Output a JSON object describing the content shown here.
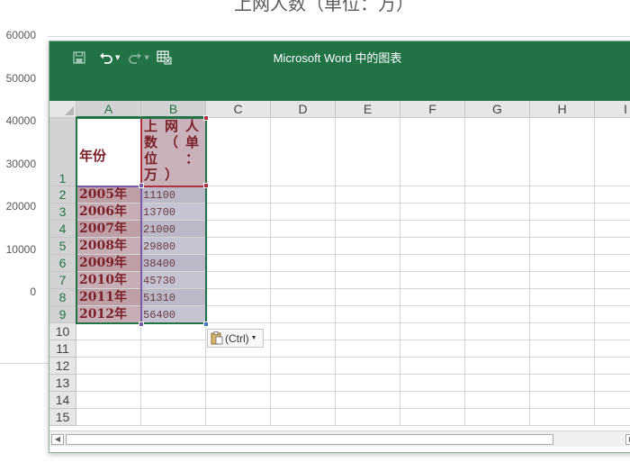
{
  "background": {
    "chart_title": "上网人数（单位：万）",
    "y_ticks": [
      "60000",
      "50000",
      "40000",
      "30000",
      "20000",
      "10000",
      "0"
    ]
  },
  "window": {
    "title": "Microsoft Word 中的图表"
  },
  "quick_access": {
    "save_icon": "save-icon",
    "undo_icon": "undo-icon",
    "redo_icon": "redo-icon",
    "edit_data_icon": "edit-data-in-excel-icon"
  },
  "columns": [
    "A",
    "B",
    "C",
    "D",
    "E",
    "F",
    "G",
    "H",
    "I"
  ],
  "rows": [
    "1",
    "2",
    "3",
    "4",
    "5",
    "6",
    "7",
    "8",
    "9",
    "10",
    "11",
    "12",
    "13",
    "14",
    "15"
  ],
  "header_row": {
    "a1": "年份",
    "b1_chars": [
      "上",
      "网",
      "人",
      "数",
      "（",
      "单",
      "位",
      "",
      "：",
      "万",
      "）",
      ""
    ]
  },
  "data_rows": [
    {
      "year": "2005年",
      "value": "11100"
    },
    {
      "year": "2006年",
      "value": "13700"
    },
    {
      "year": "2007年",
      "value": "21000"
    },
    {
      "year": "2008年",
      "value": "29800"
    },
    {
      "year": "2009年",
      "value": "38400"
    },
    {
      "year": "2010年",
      "value": "45730"
    },
    {
      "year": "2011年",
      "value": "51310"
    },
    {
      "year": "2012年",
      "value": "56400"
    }
  ],
  "paste_options": {
    "label": "(Ctrl)",
    "icon": "paste-clipboard-icon"
  },
  "colors": {
    "excel_green": "#217346",
    "header_text": "#7b1e28",
    "ref_purple": "#7a5aa8",
    "ref_red": "#b03040"
  }
}
